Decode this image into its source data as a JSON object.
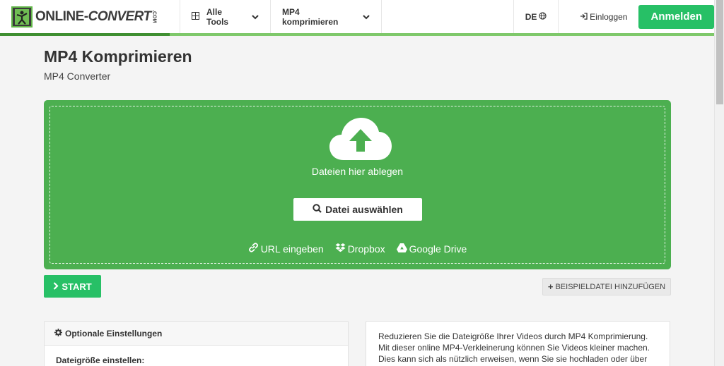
{
  "header": {
    "logo_main": "ONLINE-",
    "logo_conv": "CONVERT",
    "logo_com": ".COM",
    "nav_tools": "Alle Tools",
    "nav_mp4": "MP4 komprimieren",
    "lang": "DE",
    "login": "Einloggen",
    "signup": "Anmelden"
  },
  "page": {
    "title": "MP4 Komprimieren",
    "subtitle": "MP4 Converter"
  },
  "dropzone": {
    "drop_text": "Dateien hier ablegen",
    "select_button": "Datei auswählen",
    "sources": {
      "url": "URL eingeben",
      "dropbox": "Dropbox",
      "gdrive": "Google Drive"
    }
  },
  "actions": {
    "start": "START",
    "sample": "BEISPIELDATEI HINZUFÜGEN"
  },
  "settings": {
    "heading": "Optionale Einstellungen",
    "filesize_label": "Dateigröße einstellen:"
  },
  "description": {
    "text": "Reduzieren Sie die Dateigröße Ihrer Videos durch MP4 Komprimierung. Mit dieser online MP4-Verkleinerung können Sie Videos kleiner machen. Dies kann sich als nützlich erweisen, wenn Sie sie hochladen oder über"
  },
  "colors": {
    "brand_green": "#4caf50",
    "button_green": "#27c066",
    "dark": "#3a3a3a"
  },
  "icons": [
    "grid-icon",
    "chevron-down-icon",
    "globe-icon",
    "login-icon",
    "cloud-upload-icon",
    "search-icon",
    "link-icon",
    "dropbox-icon",
    "google-drive-icon",
    "chevron-right-icon",
    "plus-icon",
    "gear-icon"
  ]
}
